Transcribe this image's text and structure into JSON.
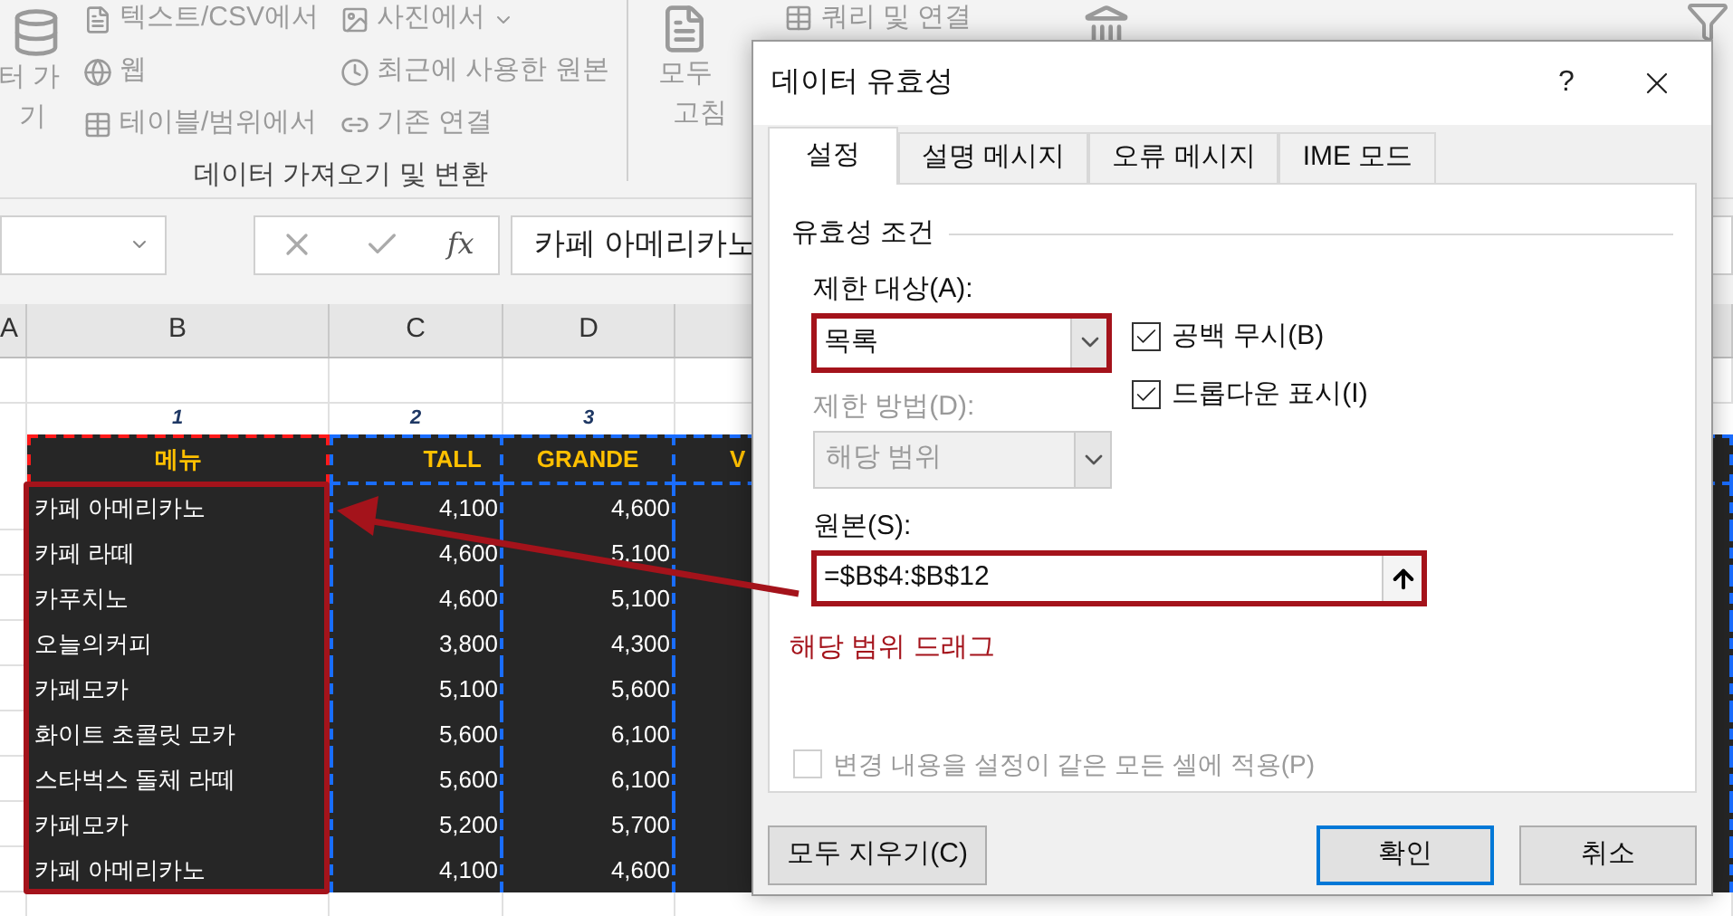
{
  "ribbon": {
    "get_data_lines": [
      "터 가",
      "기"
    ],
    "items": [
      {
        "label": "텍스트/CSV에서",
        "kind": "text"
      },
      {
        "label": "웹",
        "kind": "web"
      },
      {
        "label": "테이블/범위에서",
        "kind": "table"
      },
      {
        "label": "사진에서",
        "kind": "image"
      },
      {
        "label": "최근에 사용한 원본",
        "kind": "recent"
      },
      {
        "label": "기존 연결",
        "kind": "link"
      }
    ],
    "group_label": "데이터 가져오기 및 변환",
    "refresh_lines": [
      "모두",
      "고침"
    ],
    "queries_item": "쿼리 및 연결"
  },
  "formula_bar": {
    "fx": "fx",
    "value": "카페 아메리카노"
  },
  "sheet": {
    "column_headers": [
      "A",
      "B",
      "C",
      "D"
    ],
    "index_row": [
      "1",
      "2",
      "3"
    ],
    "header_row": [
      "메뉴",
      "TALL",
      "GRANDE",
      "V"
    ],
    "rows": [
      {
        "menu": "카페 아메리카노",
        "tall": "4,100",
        "grande": "4,600"
      },
      {
        "menu": "카페 라떼",
        "tall": "4,600",
        "grande": "5,100"
      },
      {
        "menu": "카푸치노",
        "tall": "4,600",
        "grande": "5,100"
      },
      {
        "menu": "오늘의커피",
        "tall": "3,800",
        "grande": "4,300"
      },
      {
        "menu": "카페모카",
        "tall": "5,100",
        "grande": "5,600"
      },
      {
        "menu": "화이트 초콜릿 모카",
        "tall": "5,600",
        "grande": "6,100"
      },
      {
        "menu": "스타벅스 돌체 라떼",
        "tall": "5,600",
        "grande": "6,100"
      },
      {
        "menu": "카페모카",
        "tall": "5,200",
        "grande": "5,700"
      },
      {
        "menu": "카페 아메리카노",
        "tall": "4,100",
        "grande": "4,600"
      }
    ]
  },
  "dialog": {
    "title": "데이터 유효성",
    "help": "?",
    "tabs": [
      {
        "label": "설정",
        "selected": true
      },
      {
        "label": "설명 메시지",
        "selected": false
      },
      {
        "label": "오류 메시지",
        "selected": false
      },
      {
        "label": "IME 모드",
        "selected": false
      }
    ],
    "section": "유효성 조건",
    "allow_label": "제한 대상(A):",
    "allow_value": "목록",
    "checkboxes": [
      {
        "label": "공백 무시(B)",
        "checked": true
      },
      {
        "label": "드롭다운 표시(I)",
        "checked": true
      }
    ],
    "data_label": "제한 방법(D):",
    "data_value": "해당 범위",
    "data_disabled": true,
    "source_label": "원본(S):",
    "source_value": "=$B$4:$B$12",
    "annotation": "해당 범위 드래그",
    "apply_all": {
      "label": "변경 내용을 설정이 같은 모든 셀에 적용(P)",
      "checked": false,
      "disabled": true
    },
    "clear_button": "모두 지우기(C)",
    "ok_button": "확인",
    "cancel_button": "취소"
  }
}
